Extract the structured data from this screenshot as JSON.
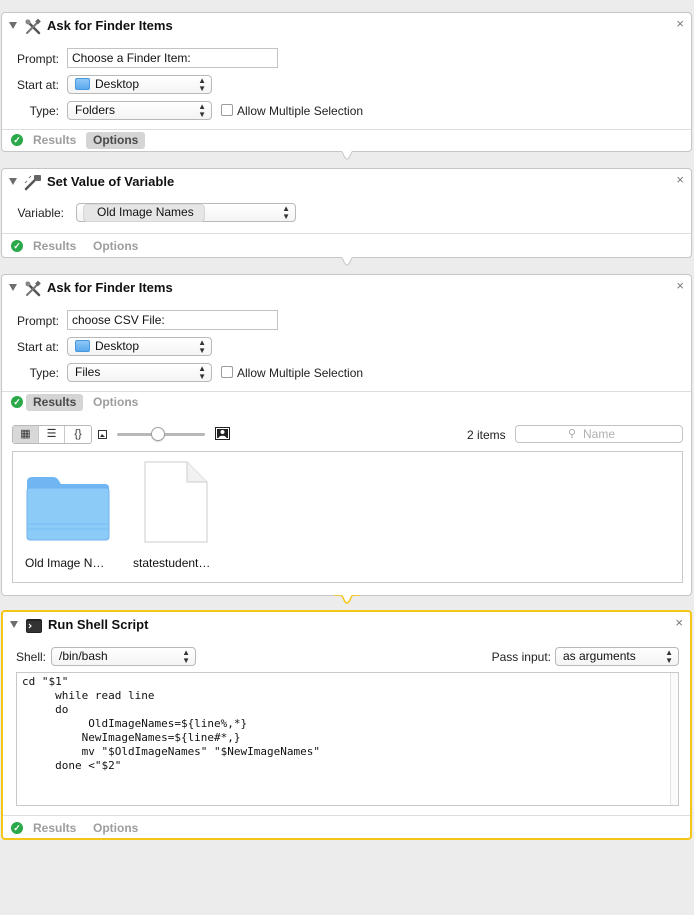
{
  "colors": {
    "selected_border": "#f5c518",
    "success_green": "#2aa84a",
    "folder_blue": "#5aa9ee"
  },
  "actions": [
    {
      "title": "Ask for Finder Items",
      "icon": "finder-tools-icon",
      "close": "×",
      "prompt_label": "Prompt:",
      "prompt_value": "Choose a Finder Item:",
      "start_at_label": "Start at:",
      "start_at_value": "Desktop",
      "type_label": "Type:",
      "type_value": "Folders",
      "allow_multiple_label": "Allow Multiple Selection",
      "allow_multiple_checked": false,
      "results_tab": "Results",
      "options_tab": "Options",
      "active_tab": "Options"
    },
    {
      "title": "Set Value of Variable",
      "icon": "variable-icon",
      "close": "×",
      "variable_label": "Variable:",
      "variable_value": "Old Image Names",
      "results_tab": "Results",
      "options_tab": "Options",
      "active_tab": "none"
    },
    {
      "title": "Ask for Finder Items",
      "icon": "finder-tools-icon",
      "close": "×",
      "prompt_label": "Prompt:",
      "prompt_value": "choose CSV File:",
      "start_at_label": "Start at:",
      "start_at_value": "Desktop",
      "type_label": "Type:",
      "type_value": "Files",
      "allow_multiple_label": "Allow Multiple Selection",
      "allow_multiple_checked": false,
      "results_tab": "Results",
      "options_tab": "Options",
      "active_tab": "Results",
      "view_buttons": [
        "grid-view-icon",
        "list-view-icon",
        "braces-view-icon"
      ],
      "item_count": "2 items",
      "search_placeholder": "Name",
      "icon_size_fraction": 0.47,
      "items": [
        {
          "name": "Old Image N…",
          "kind": "folder"
        },
        {
          "name": "statestudent…",
          "kind": "document"
        }
      ]
    },
    {
      "title": "Run Shell Script",
      "icon": "terminal-icon",
      "close": "×",
      "shell_label": "Shell:",
      "shell_value": "/bin/bash",
      "pass_input_label": "Pass input:",
      "pass_input_value": "as arguments",
      "script": "cd \"$1\"\n     while read line\n     do\n          OldImageNames=${line%,*}\n         NewImageNames=${line#*,}\n         mv \"$OldImageNames\" \"$NewImageNames\"\n     done <\"$2\"",
      "results_tab": "Results",
      "options_tab": "Options",
      "active_tab": "none"
    }
  ]
}
